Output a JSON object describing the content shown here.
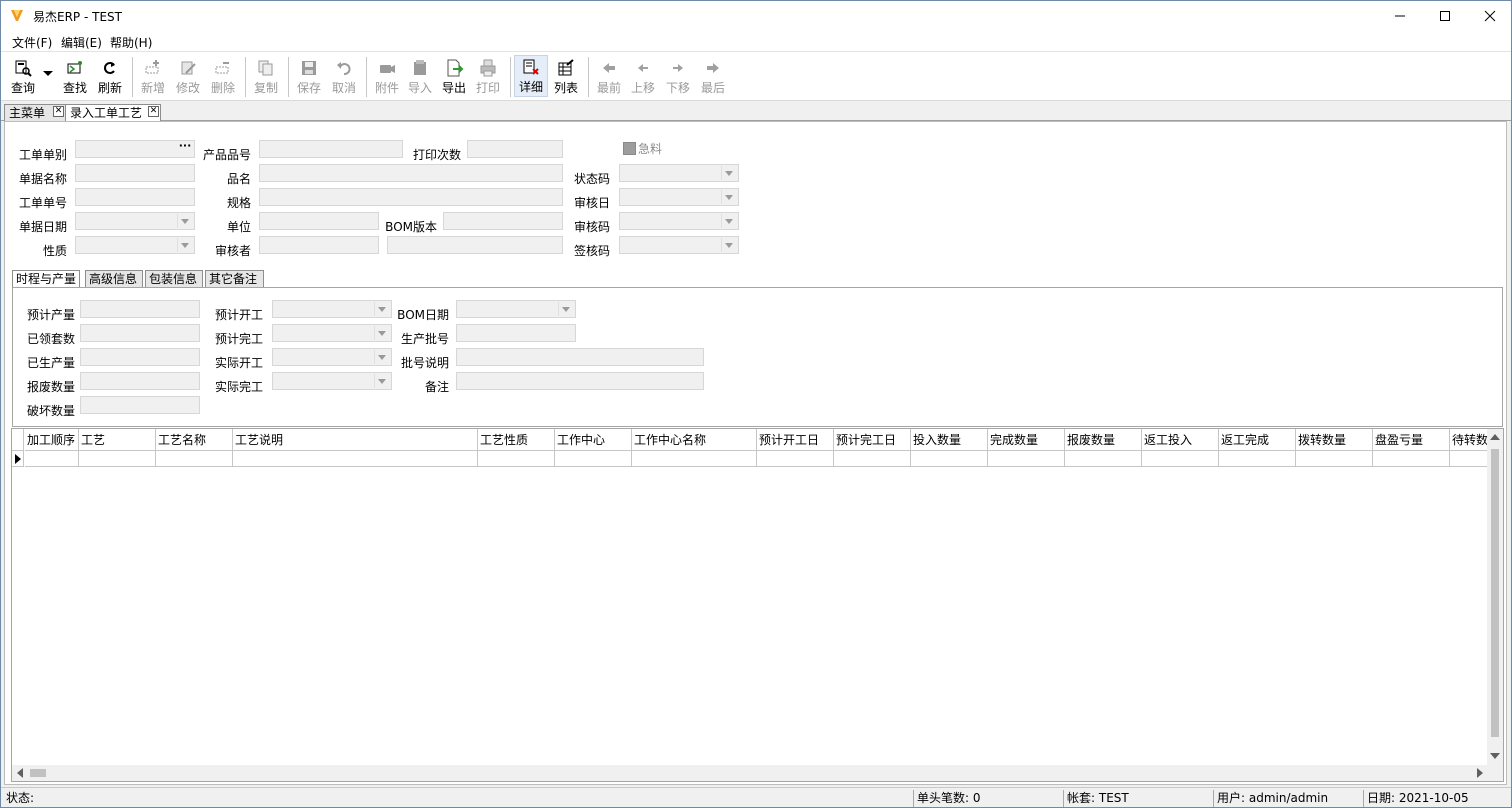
{
  "window": {
    "title": "易杰ERP - TEST",
    "minimize": "—",
    "maximize": "☐",
    "close": "✕"
  },
  "menu": {
    "file": "文件(F)",
    "edit": "编辑(E)",
    "help": "帮助(H)"
  },
  "toolbar": {
    "query": "查询",
    "find": "查找",
    "refresh": "刷新",
    "add": "新增",
    "modify": "修改",
    "delete": "删除",
    "copy": "复制",
    "save": "保存",
    "cancel": "取消",
    "attachment": "附件",
    "import": "导入",
    "export": "导出",
    "print": "打印",
    "detail": "详细",
    "list": "列表",
    "first": "最前",
    "prev": "上移",
    "next": "下移",
    "last": "最后"
  },
  "doctabs": {
    "main_menu": "主菜单",
    "entry": "录入工单工艺"
  },
  "header_form": {
    "order_type": "工单单别",
    "product_no": "产品品号",
    "print_count": "打印次数",
    "urgent": "急料",
    "doc_name": "单据名称",
    "product_name": "品名",
    "status_code": "状态码",
    "order_no": "工单单号",
    "spec": "规格",
    "audit_date": "审核日",
    "doc_date": "单据日期",
    "unit": "单位",
    "bom_version": "BOM版本",
    "audit_code": "审核码",
    "nature": "性质",
    "auditor": "审核者",
    "sign_code": "签核码",
    "ellipsis": "···"
  },
  "inner_tabs": [
    "时程与产量",
    "高级信息",
    "包装信息",
    "其它备注"
  ],
  "schedule_form": {
    "planned_qty": "预计产量",
    "planned_start": "预计开工",
    "bom_date": "BOM日期",
    "received_sets": "已领套数",
    "planned_finish": "预计完工",
    "batch_no": "生产批号",
    "produced_qty": "已生产量",
    "actual_start": "实际开工",
    "batch_desc": "批号说明",
    "scrap_qty": "报废数量",
    "actual_finish": "实际完工",
    "remark": "备注",
    "damaged_qty": "破坏数量"
  },
  "grid": {
    "columns": [
      "加工顺序",
      "工艺",
      "工艺名称",
      "工艺说明",
      "工艺性质",
      "工作中心",
      "工作中心名称",
      "预计开工日",
      "预计完工日",
      "投入数量",
      "完成数量",
      "报废数量",
      "返工投入",
      "返工完成",
      "拨转数量",
      "盘盈亏量",
      "待转数"
    ]
  },
  "statusbar": {
    "status": "状态:",
    "header_count": "单头笔数: 0",
    "account": "帐套: TEST",
    "user": "用户: admin/admin",
    "date": "日期: 2021-10-05"
  }
}
